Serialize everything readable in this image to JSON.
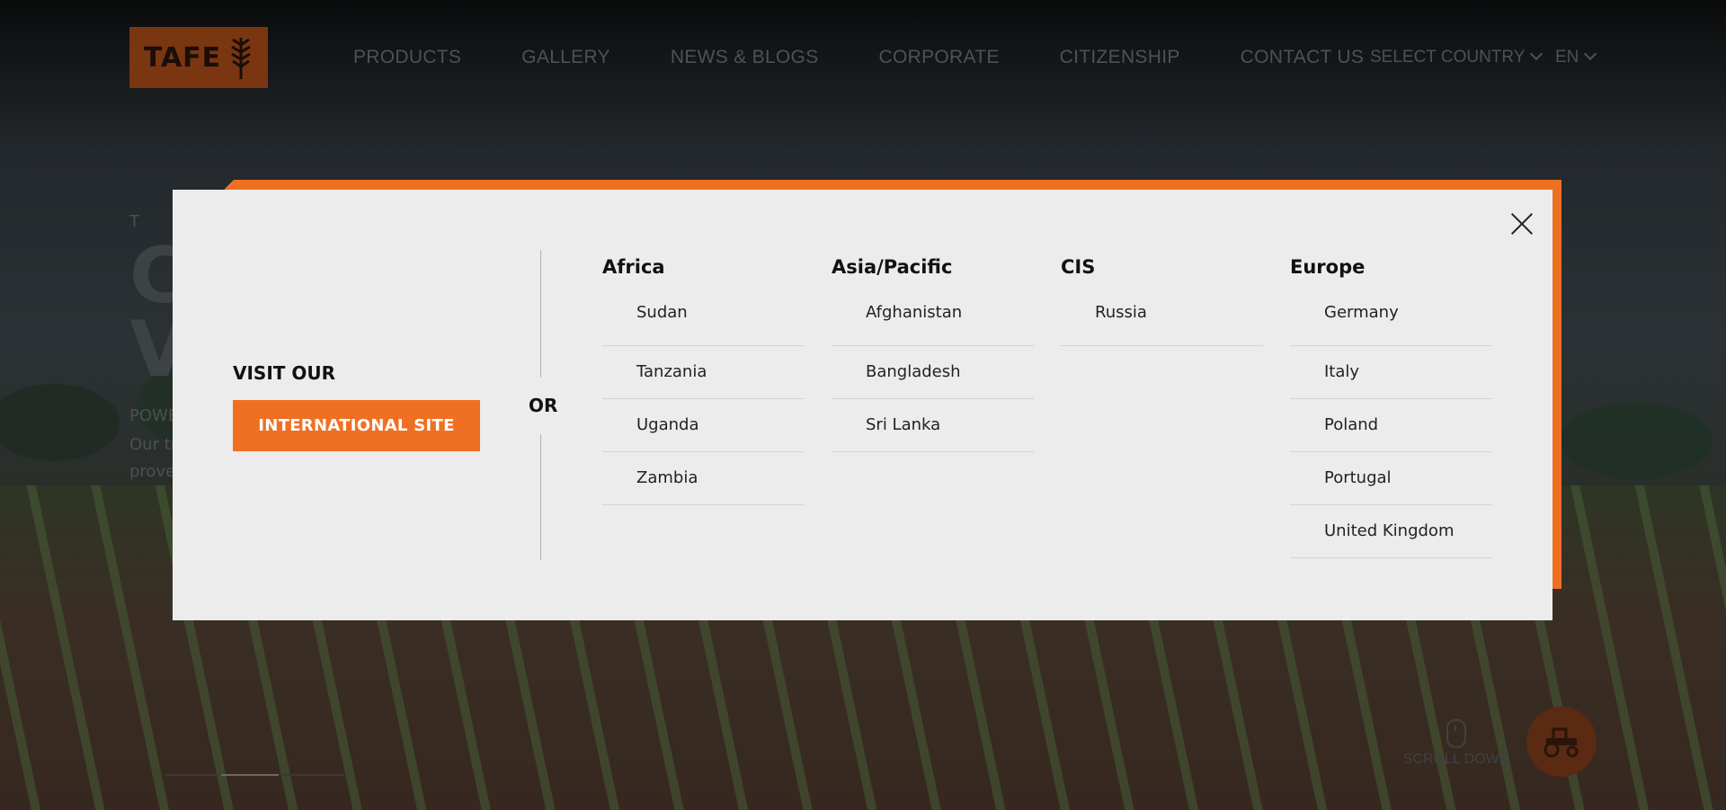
{
  "header": {
    "logo_text": "TAFE",
    "nav": [
      "PRODUCTS",
      "GALLERY",
      "NEWS & BLOGS",
      "CORPORATE",
      "CITIZENSHIP",
      "CONTACT US"
    ],
    "country_select": "SELECT COUNTRY",
    "lang_select": "EN"
  },
  "hero": {
    "kicker": "T A",
    "big_line1": "C",
    "big_line2": "V",
    "sub": "POWE",
    "copy_line1": "Our tr",
    "copy_line2": "prove"
  },
  "widgets": {
    "scroll_down": "SCROLL DOWN"
  },
  "modal": {
    "visit_label": "VISIT OUR",
    "international_button": "INTERNATIONAL SITE",
    "or_label": "OR",
    "regions": [
      {
        "title": "Africa",
        "countries": [
          "Sudan",
          "Tanzania",
          "Uganda",
          "Zambia"
        ]
      },
      {
        "title": "Asia/Pacific",
        "countries": [
          "Afghanistan",
          "Bangladesh",
          "Sri Lanka"
        ]
      },
      {
        "title": "CIS",
        "countries": [
          "Russia"
        ]
      },
      {
        "title": "Europe",
        "countries": [
          "Germany",
          "Italy",
          "Poland",
          "Portugal",
          "United Kingdom"
        ]
      }
    ]
  },
  "colors": {
    "accent": "#f07023",
    "modal_bg": "#ececec",
    "logo_bg": "#7a3511"
  }
}
